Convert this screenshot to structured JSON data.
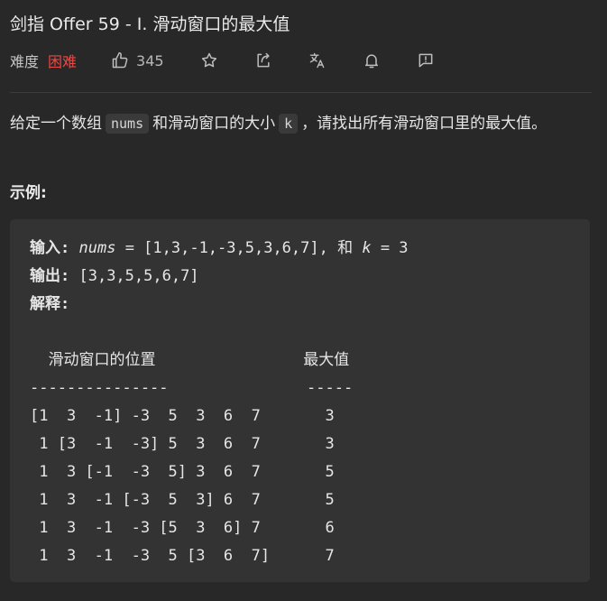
{
  "problem": {
    "title": "剑指 Offer 59 - I. 滑动窗口的最大值",
    "difficulty_label": "难度",
    "difficulty": "困难",
    "likes": "345"
  },
  "description": {
    "part1": "给定一个数组",
    "code1": "nums",
    "part2": "和滑动窗口的大小",
    "code2": "k",
    "part3": "，请找出所有滑动窗口里的最大值。"
  },
  "example": {
    "label": "示例:",
    "input_label": "输入:",
    "input_var": "nums",
    "input_eq": " = [1,3,-1,-3,5,3,6,7], 和 ",
    "input_k": "k",
    "input_tail": " = 3",
    "output_label": "输出:",
    "output_value": " [3,3,5,5,6,7]",
    "explain_label": "解释:",
    "table_text": "\n  滑动窗口的位置                最大值\n---------------               -----\n[1  3  -1] -3  5  3  6  7       3\n 1 [3  -1  -3] 5  3  6  7       3\n 1  3 [-1  -3  5] 3  6  7       5\n 1  3  -1 [-3  5  3] 6  7       5\n 1  3  -1  -3 [5  3  6] 7       6\n 1  3  -1  -3  5 [3  6  7]      7"
  },
  "colors": {
    "background": "#282828",
    "difficulty_hard": "#ef4743",
    "code_bg": "#333333"
  },
  "icons": [
    "thumbs-up-icon",
    "star-icon",
    "share-icon",
    "translate-icon",
    "bell-icon",
    "feedback-icon"
  ]
}
